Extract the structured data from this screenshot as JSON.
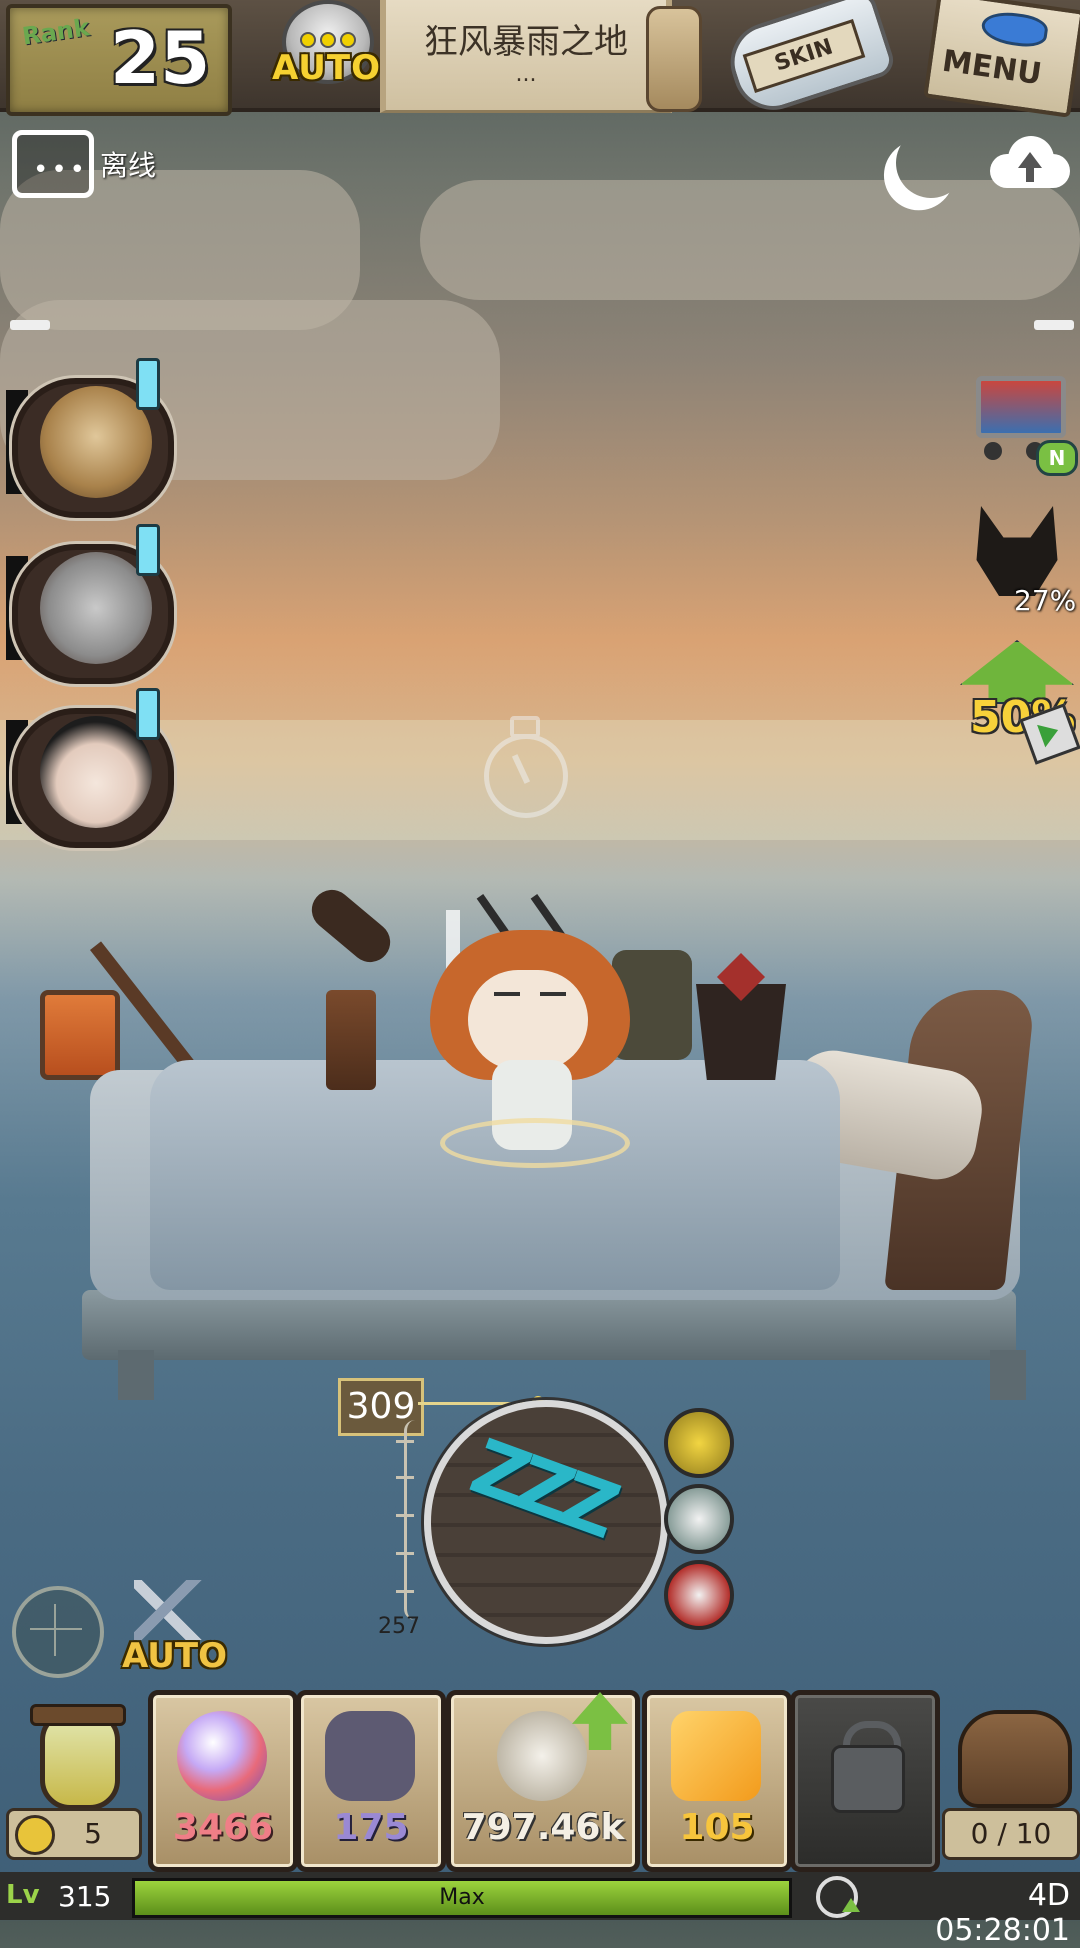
{
  "top_bar": {
    "rank_label": "Rank",
    "rank_value": "25",
    "auto_label": "AUTO",
    "location_title": "狂风暴雨之地",
    "location_subtitle": "...",
    "skin_label": "SKIN",
    "menu_label": "MENU"
  },
  "chat": {
    "status_label": "离线"
  },
  "portraits": [
    {
      "name": "deer-character"
    },
    {
      "name": "wolf-character"
    },
    {
      "name": "girl-character"
    }
  ],
  "right_side": {
    "shop_badge": "N",
    "mask_percent": "27%",
    "boost_percent": "50%"
  },
  "sleep_dial": {
    "top_value": "309",
    "bottom_value": "257",
    "zzz": "ZZZ"
  },
  "auto_battle_label": "AUTO",
  "inventory": {
    "hourglass_count": "5",
    "orb": "3466",
    "shield": "175",
    "gear": "797.46k",
    "crystal": "105",
    "bag_count": "0 / 10"
  },
  "status_bar": {
    "level": "315",
    "xp_label": "Max",
    "xp_progress": 1.0,
    "timer": "4D 05:28:01"
  },
  "colors": {
    "accent_yellow": "#f6d131",
    "xp_green": "#9cd33d",
    "zzz_cyan": "#2ab7c8"
  }
}
